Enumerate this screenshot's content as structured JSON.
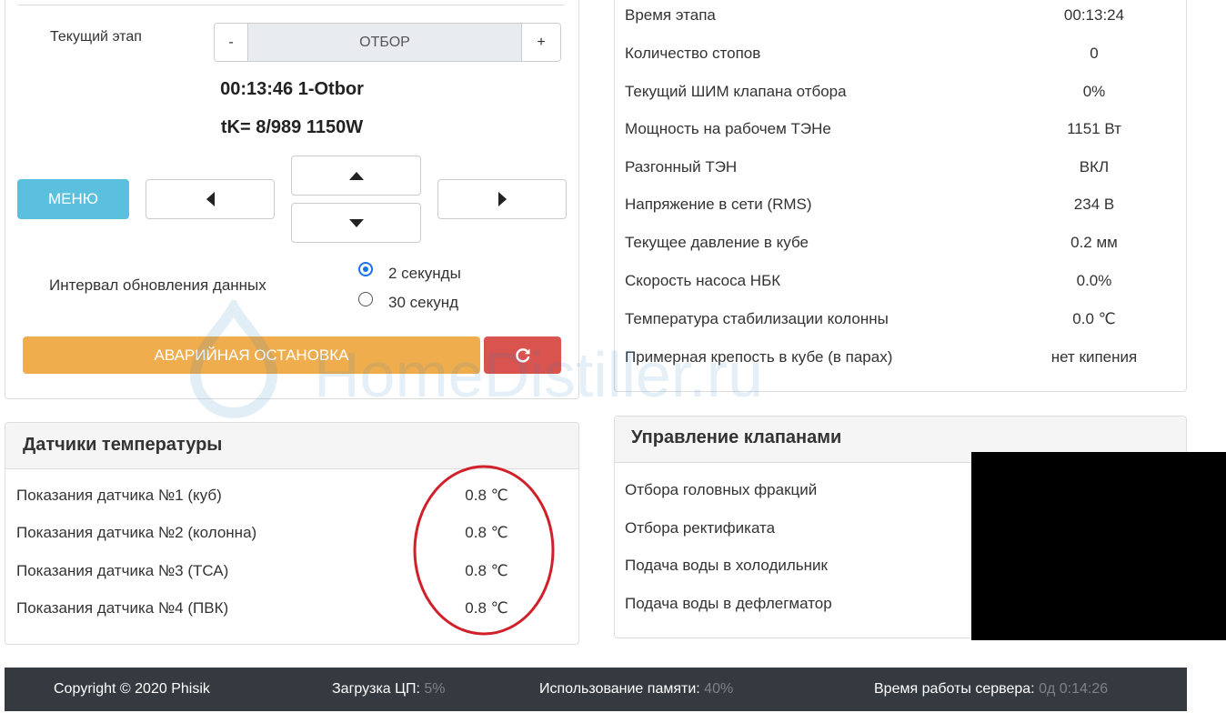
{
  "control": {
    "stage_label": "Текущий этап",
    "stage_minus": "-",
    "stage_value": "ОТБОР",
    "stage_plus": "+",
    "status_line1": "00:13:46 1-Otbor",
    "status_line2": "tK= 8/989 1150W",
    "menu_label": "МЕНЮ",
    "refresh_label": "Интервал обновления данных",
    "refresh_options": [
      "2 секунды",
      "30 секунд"
    ],
    "refresh_selected": "2 секунды",
    "emergency_label": "АВАРИЙНАЯ ОСТАНОВКА",
    "accent_color": "#5bc0de",
    "warning_color": "#f0ad4e",
    "danger_color": "#d9534f"
  },
  "info": {
    "rows": [
      {
        "label": "Время этапа",
        "value": "00:13:24"
      },
      {
        "label": "Количество стопов",
        "value": "0"
      },
      {
        "label": "Текущий ШИМ клапана отбора",
        "value": "0%"
      },
      {
        "label": "Мощность на рабочем ТЭНе",
        "value": "1151 Вт"
      },
      {
        "label": "Разгонный ТЭН",
        "value": "ВКЛ"
      },
      {
        "label": "Напряжение в сети (RMS)",
        "value": "234 В"
      },
      {
        "label": "Текущее давление в кубе",
        "value": "0.2 мм"
      },
      {
        "label": "Скорость насоса НБК",
        "value": "0.0%"
      },
      {
        "label": "Температура стабилизации колонны",
        "value": "0.0 ℃"
      },
      {
        "label": "Примерная крепость в кубе (в парах)",
        "value": "нет кипения"
      }
    ]
  },
  "sensors": {
    "title": "Датчики температуры",
    "rows": [
      {
        "label": "Показания датчика №1 (куб)",
        "value": "0.8 ℃"
      },
      {
        "label": "Показания датчика №2 (колонна)",
        "value": "0.8 ℃"
      },
      {
        "label": "Показания датчика №3 (ТСА)",
        "value": "0.8 ℃"
      },
      {
        "label": "Показания датчика №4 (ПВК)",
        "value": "0.8 ℃"
      }
    ]
  },
  "valves": {
    "title": "Управление клапанами",
    "rows": [
      "Отбора головных фракций",
      "Отбора ректификата",
      "Подача воды в холодильник",
      "Подача воды в дефлегматор"
    ]
  },
  "watermark": "HomeDistiller.ru",
  "footer": {
    "copyright": "Copyright © 2020 Phisik",
    "cpu_label": "Загрузка ЦП:",
    "cpu_value": "5%",
    "mem_label": "Использование памяти:",
    "mem_value": "40%",
    "uptime_label": "Время работы сервера:",
    "uptime_value": "0д 0:14:26"
  }
}
